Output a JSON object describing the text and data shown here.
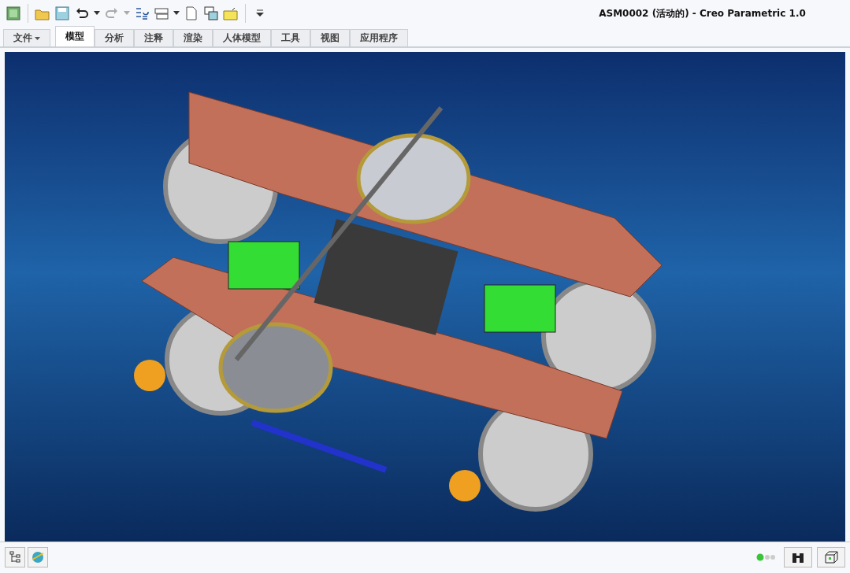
{
  "window": {
    "title": "ASM0002 (活动的) - Creo Parametric 1.0"
  },
  "file_menu": {
    "label": "文件"
  },
  "tabs": [
    {
      "label": "模型",
      "selected": true
    },
    {
      "label": "分析",
      "selected": false
    },
    {
      "label": "注释",
      "selected": false
    },
    {
      "label": "渲染",
      "selected": false
    },
    {
      "label": "人体模型",
      "selected": false
    },
    {
      "label": "工具",
      "selected": false
    },
    {
      "label": "视图",
      "selected": false
    },
    {
      "label": "应用程序",
      "selected": false
    }
  ]
}
